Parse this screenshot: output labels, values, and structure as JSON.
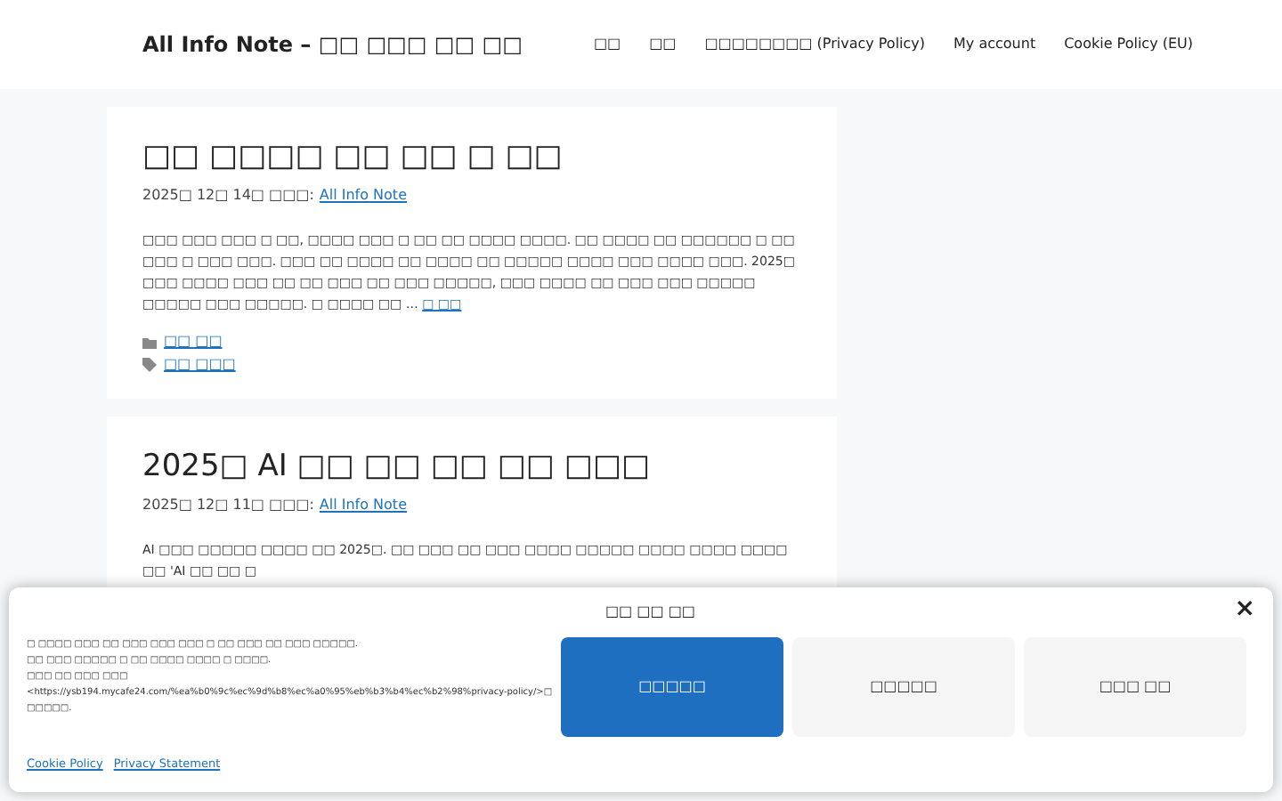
{
  "site_title": "All Info Note – □□ □□□ □□ □□",
  "nav": [
    {
      "label": "□□"
    },
    {
      "label": "□□"
    },
    {
      "label": "□□□□□□□□ (Privacy Policy)"
    },
    {
      "label": "My account"
    },
    {
      "label": "Cookie Policy (EU)"
    }
  ],
  "posts": [
    {
      "title": "□□ □□□□ □□ □□ □ □□",
      "date": "2025□ 12□ 14□ □□□:",
      "author": "All Info Note",
      "excerpt": "□□□ □□□ □□□ □ □□, □□□□ □□□ □ □□ □□ □□□□ □□□□. □□ □□□□ □□ □□□□□□ □ □□ □□□ □ □□□ □□□. □□□ □□ □□□□ □□ □□□□ □□ □□□□□ □□□□ □□□ □□□□ □□□. 2025□ □□□ □□□□ □□□ □□ □□ □□□ □□ □□□ □□□□□, □□□ □□□□ □□ □□□ □□□ □□□□□ □□□□□ □□□ □□□□□. □ □□□□ □□ …",
      "read_more": "□ □□",
      "category": "□□ □□",
      "tag": "□□ □□□"
    },
    {
      "title": "2025□ AI □□ □□ □□ □□ □□□",
      "date": "2025□ 12□ 11□ □□□:",
      "author": "All Info Note",
      "excerpt": "AI □□□ □□□□□ □□□□ □□ 2025□. □□ □□□ □□ □□□ □□□□ □□□□□ □□□□ □□□□ □□□□ □□ 'AI □□ □□ □"
    }
  ],
  "cookie_banner": {
    "title": "□□ □□ □□",
    "lines": [
      "□ □□□□ □□□ □□ □□□ □□□ □□□ □ □□ □□□ □□ □□□ □□□□□.",
      "□□ □□□ □□□□□ □ □□ □□□□ □□□□ □ □□□□.",
      "□□□ □□ □□□ □□□",
      "<https://ysb194.mycafe24.com/%ea%b0%9c%ec%9d%b8%ec%a0%95%eb%b3%b4%ec%b2%98%privacy-policy/>□ □□□□□."
    ],
    "links": [
      "Cookie Policy",
      "Privacy Statement"
    ],
    "buttons": [
      {
        "label": "□□□□□",
        "kind": "primary"
      },
      {
        "label": "□□□□□",
        "kind": "secondary"
      },
      {
        "label": "□□□ □□",
        "kind": "secondary"
      }
    ],
    "close": "×"
  }
}
